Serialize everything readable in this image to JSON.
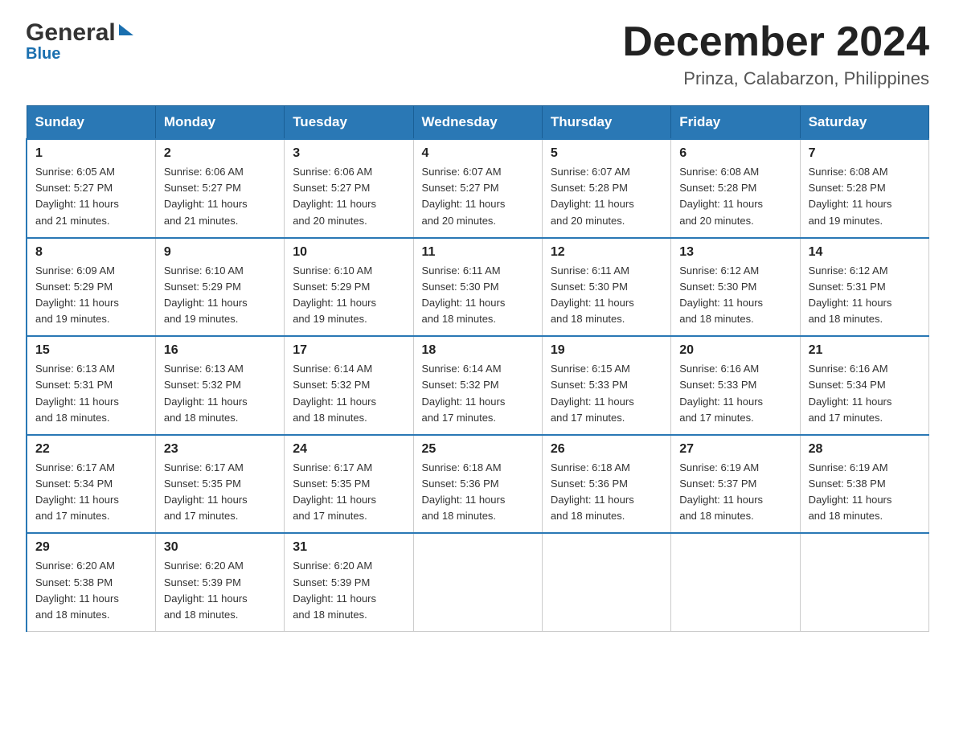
{
  "header": {
    "logo_general": "General",
    "logo_blue": "Blue",
    "month": "December 2024",
    "location": "Prinza, Calabarzon, Philippines"
  },
  "days_of_week": [
    "Sunday",
    "Monday",
    "Tuesday",
    "Wednesday",
    "Thursday",
    "Friday",
    "Saturday"
  ],
  "weeks": [
    [
      {
        "day": "1",
        "sunrise": "6:05 AM",
        "sunset": "5:27 PM",
        "daylight": "11 hours and 21 minutes."
      },
      {
        "day": "2",
        "sunrise": "6:06 AM",
        "sunset": "5:27 PM",
        "daylight": "11 hours and 21 minutes."
      },
      {
        "day": "3",
        "sunrise": "6:06 AM",
        "sunset": "5:27 PM",
        "daylight": "11 hours and 20 minutes."
      },
      {
        "day": "4",
        "sunrise": "6:07 AM",
        "sunset": "5:27 PM",
        "daylight": "11 hours and 20 minutes."
      },
      {
        "day": "5",
        "sunrise": "6:07 AM",
        "sunset": "5:28 PM",
        "daylight": "11 hours and 20 minutes."
      },
      {
        "day": "6",
        "sunrise": "6:08 AM",
        "sunset": "5:28 PM",
        "daylight": "11 hours and 20 minutes."
      },
      {
        "day": "7",
        "sunrise": "6:08 AM",
        "sunset": "5:28 PM",
        "daylight": "11 hours and 19 minutes."
      }
    ],
    [
      {
        "day": "8",
        "sunrise": "6:09 AM",
        "sunset": "5:29 PM",
        "daylight": "11 hours and 19 minutes."
      },
      {
        "day": "9",
        "sunrise": "6:10 AM",
        "sunset": "5:29 PM",
        "daylight": "11 hours and 19 minutes."
      },
      {
        "day": "10",
        "sunrise": "6:10 AM",
        "sunset": "5:29 PM",
        "daylight": "11 hours and 19 minutes."
      },
      {
        "day": "11",
        "sunrise": "6:11 AM",
        "sunset": "5:30 PM",
        "daylight": "11 hours and 18 minutes."
      },
      {
        "day": "12",
        "sunrise": "6:11 AM",
        "sunset": "5:30 PM",
        "daylight": "11 hours and 18 minutes."
      },
      {
        "day": "13",
        "sunrise": "6:12 AM",
        "sunset": "5:30 PM",
        "daylight": "11 hours and 18 minutes."
      },
      {
        "day": "14",
        "sunrise": "6:12 AM",
        "sunset": "5:31 PM",
        "daylight": "11 hours and 18 minutes."
      }
    ],
    [
      {
        "day": "15",
        "sunrise": "6:13 AM",
        "sunset": "5:31 PM",
        "daylight": "11 hours and 18 minutes."
      },
      {
        "day": "16",
        "sunrise": "6:13 AM",
        "sunset": "5:32 PM",
        "daylight": "11 hours and 18 minutes."
      },
      {
        "day": "17",
        "sunrise": "6:14 AM",
        "sunset": "5:32 PM",
        "daylight": "11 hours and 18 minutes."
      },
      {
        "day": "18",
        "sunrise": "6:14 AM",
        "sunset": "5:32 PM",
        "daylight": "11 hours and 17 minutes."
      },
      {
        "day": "19",
        "sunrise": "6:15 AM",
        "sunset": "5:33 PM",
        "daylight": "11 hours and 17 minutes."
      },
      {
        "day": "20",
        "sunrise": "6:16 AM",
        "sunset": "5:33 PM",
        "daylight": "11 hours and 17 minutes."
      },
      {
        "day": "21",
        "sunrise": "6:16 AM",
        "sunset": "5:34 PM",
        "daylight": "11 hours and 17 minutes."
      }
    ],
    [
      {
        "day": "22",
        "sunrise": "6:17 AM",
        "sunset": "5:34 PM",
        "daylight": "11 hours and 17 minutes."
      },
      {
        "day": "23",
        "sunrise": "6:17 AM",
        "sunset": "5:35 PM",
        "daylight": "11 hours and 17 minutes."
      },
      {
        "day": "24",
        "sunrise": "6:17 AM",
        "sunset": "5:35 PM",
        "daylight": "11 hours and 17 minutes."
      },
      {
        "day": "25",
        "sunrise": "6:18 AM",
        "sunset": "5:36 PM",
        "daylight": "11 hours and 18 minutes."
      },
      {
        "day": "26",
        "sunrise": "6:18 AM",
        "sunset": "5:36 PM",
        "daylight": "11 hours and 18 minutes."
      },
      {
        "day": "27",
        "sunrise": "6:19 AM",
        "sunset": "5:37 PM",
        "daylight": "11 hours and 18 minutes."
      },
      {
        "day": "28",
        "sunrise": "6:19 AM",
        "sunset": "5:38 PM",
        "daylight": "11 hours and 18 minutes."
      }
    ],
    [
      {
        "day": "29",
        "sunrise": "6:20 AM",
        "sunset": "5:38 PM",
        "daylight": "11 hours and 18 minutes."
      },
      {
        "day": "30",
        "sunrise": "6:20 AM",
        "sunset": "5:39 PM",
        "daylight": "11 hours and 18 minutes."
      },
      {
        "day": "31",
        "sunrise": "6:20 AM",
        "sunset": "5:39 PM",
        "daylight": "11 hours and 18 minutes."
      },
      null,
      null,
      null,
      null
    ]
  ],
  "labels": {
    "sunrise": "Sunrise:",
    "sunset": "Sunset:",
    "daylight": "Daylight:"
  }
}
